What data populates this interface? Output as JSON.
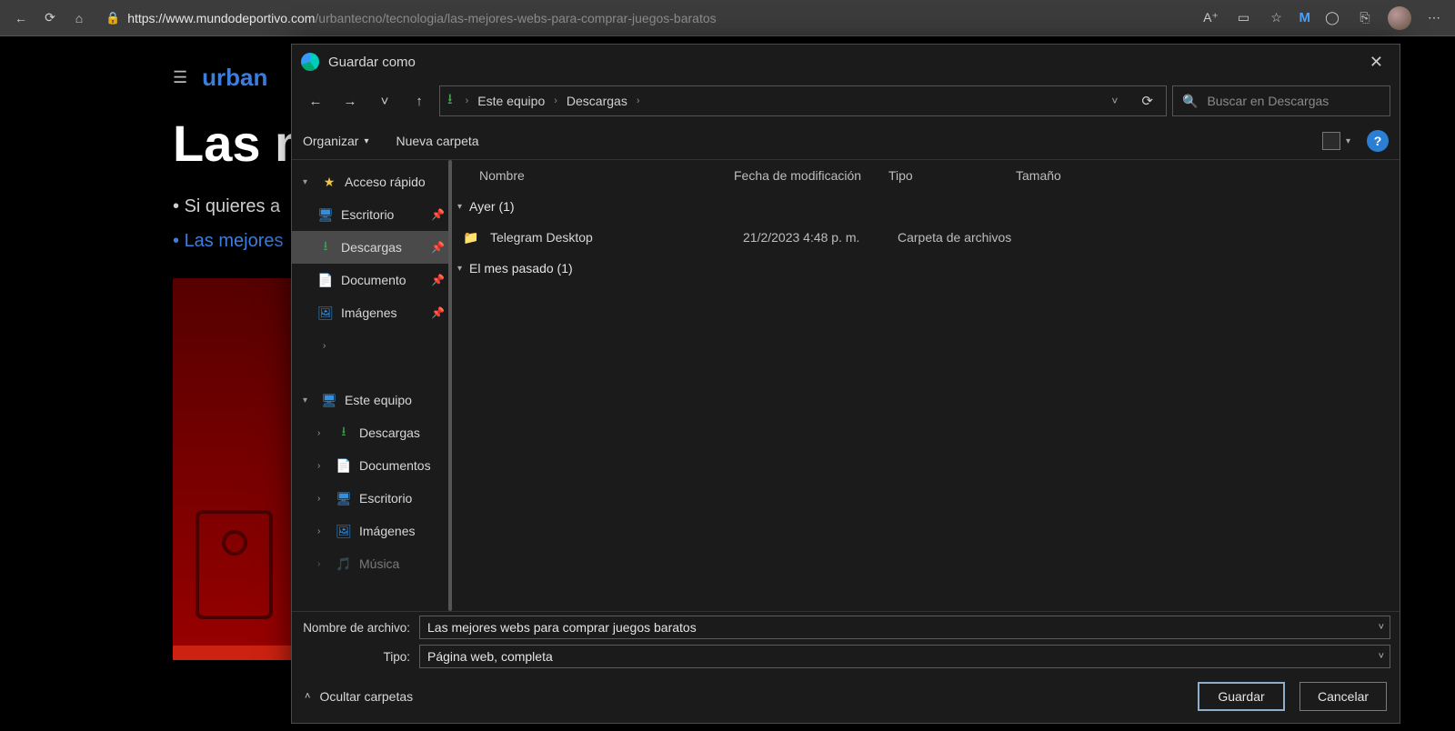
{
  "browser": {
    "url_host": "https://www.mundodeportivo.com",
    "url_path": "/urbantecno/tecnologia/las-mejores-webs-para-comprar-juegos-baratos",
    "right_icons": {
      "mfa": "M"
    }
  },
  "page": {
    "brand": "urban",
    "headline": "Las m",
    "bullets": [
      {
        "text": "Si quieres a",
        "active": false
      },
      {
        "text": "Las mejores",
        "active": true
      }
    ],
    "strip_colors": [
      "#c21",
      "#0a4",
      "#06c"
    ]
  },
  "dialog": {
    "title": "Guardar como",
    "breadcrumb": {
      "root": "Este equipo",
      "current": "Descargas"
    },
    "search_placeholder": "Buscar en Descargas",
    "toolbar": {
      "organize": "Organizar",
      "new_folder": "Nueva carpeta"
    },
    "tree": {
      "quick_access": {
        "label": "Acceso rápido",
        "items": [
          {
            "label": "Escritorio",
            "icon": "mon",
            "pin": true
          },
          {
            "label": "Descargas",
            "icon": "dl",
            "pin": true,
            "selected": true
          },
          {
            "label": "Documento",
            "icon": "doc",
            "pin": true
          },
          {
            "label": "Imágenes",
            "icon": "img",
            "pin": true
          }
        ]
      },
      "this_pc": {
        "label": "Este equipo",
        "items": [
          {
            "label": "Descargas",
            "icon": "dl"
          },
          {
            "label": "Documentos",
            "icon": "doc"
          },
          {
            "label": "Escritorio",
            "icon": "mon"
          },
          {
            "label": "Imágenes",
            "icon": "img"
          },
          {
            "label": "Música",
            "icon": "music"
          }
        ]
      }
    },
    "columns": {
      "name": "Nombre",
      "date": "Fecha de modificación",
      "type": "Tipo",
      "size": "Tamaño"
    },
    "groups": [
      {
        "label": "Ayer (1)",
        "items": [
          {
            "name": "Telegram Desktop",
            "date": "21/2/2023 4:48 p. m.",
            "type": "Carpeta de archivos"
          }
        ]
      },
      {
        "label": "El mes pasado (1)",
        "items": []
      }
    ],
    "form": {
      "filename_label": "Nombre de archivo:",
      "filename_value": "Las mejores webs para comprar juegos baratos",
      "type_label": "Tipo:",
      "type_value": "Página web, completa"
    },
    "footer": {
      "hide_folders": "Ocultar carpetas",
      "save": "Guardar",
      "cancel": "Cancelar"
    }
  }
}
